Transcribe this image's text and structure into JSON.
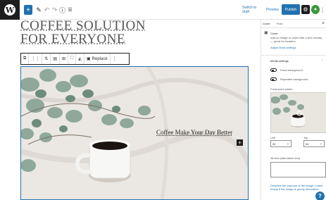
{
  "toolbar": {
    "wp_logo": "W",
    "add_label": "+",
    "undo": "↶",
    "redo": "↷",
    "info": "ⓘ",
    "list": "☰",
    "switch_to_draft": "Switch to draft",
    "preview": "Preview",
    "publish": "Publish",
    "settings_icon": "gear-icon",
    "plugin_icon": "leaf-icon",
    "more_icon": "vertical-ellipsis-icon"
  },
  "editor": {
    "title_line1": "COFFEE SOLUTION",
    "title_line2": "FOR EVERYONE",
    "block_toolbar": {
      "replace": "Replace"
    },
    "cover": {
      "heading": "Coffee Make Your Day Better",
      "add": "+"
    }
  },
  "sidebar": {
    "tab_block": "Cover",
    "tab_post": "Post",
    "close": "×",
    "block_name": "Cover",
    "block_desc": "Add an image or video with a text overlay — great for headers.",
    "styles_link": "Adjust block settings",
    "media_settings": "Media settings",
    "fixed_background": "Fixed background",
    "repeated_background": "Repeated background",
    "focal_point": "Focal point picker",
    "left_label": "Left",
    "top_label": "Top",
    "left_value": "50",
    "top_value": "50",
    "alt_text": "Alt text (alternative text)",
    "alt_link": "Describe the purpose of the image. Leave empty if the image is purely decorative.",
    "help": "?"
  },
  "colors": {
    "accent": "#2271b1",
    "dark": "#1e1e1e"
  }
}
